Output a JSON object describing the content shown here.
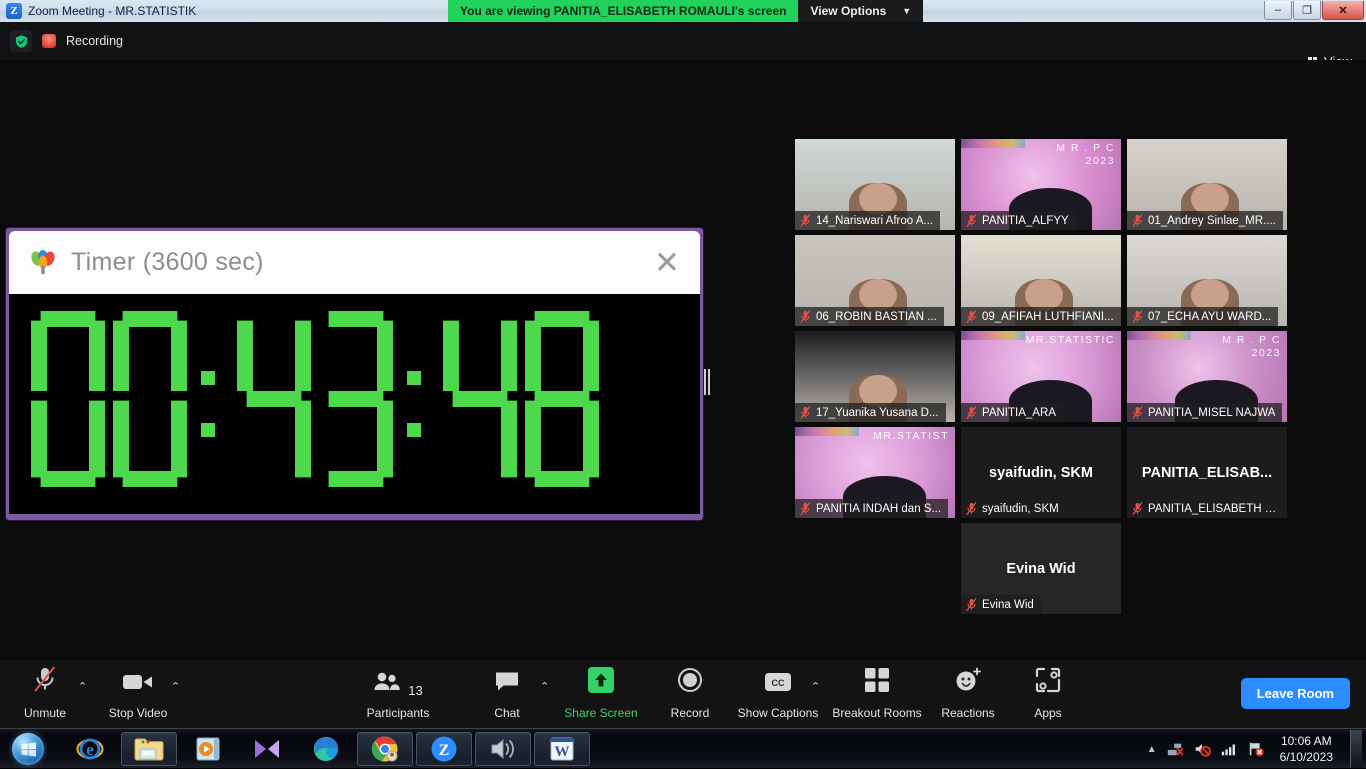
{
  "window": {
    "title": "Zoom Meeting - MR.STATISTIK",
    "app_icon": "zoom-icon",
    "minimize_label": "–",
    "restore_label": "❐",
    "close_label": "✕"
  },
  "share_banner": {
    "viewing_text": "You are viewing PANITIA_ELISABETH ROMAULI's screen",
    "view_options_label": "View Options",
    "chevron": "⌄",
    "green": "#21d35d"
  },
  "statusbar": {
    "recording_label": "Recording",
    "view_label": "View"
  },
  "timer": {
    "title": "Timer (3600 sec)",
    "close_label": "✕",
    "display": "00:43:48",
    "hours": "00",
    "minutes": "43",
    "seconds": "48",
    "segment_color": "#4dd84d",
    "frame_color": "#7b5aa0"
  },
  "tiles": [
    {
      "name": "14_Nariswari Afroo A...",
      "muted": true,
      "style": "photo",
      "bg": "#cfd9d6",
      "active": false,
      "big": ""
    },
    {
      "name": "PANITIA_ALFYY",
      "muted": true,
      "style": "virtual",
      "bg": "#d98fd0",
      "brand": "M R . P C\n2023",
      "active": false,
      "big": ""
    },
    {
      "name": "01_Andrey Sinlae_MR....",
      "muted": true,
      "style": "photo",
      "bg": "#d8d2cc",
      "active": false,
      "big": ""
    },
    {
      "name": "06_ROBIN BASTIAN ...",
      "muted": true,
      "style": "photo",
      "bg": "#c9c6bd",
      "active": false,
      "big": ""
    },
    {
      "name": "09_AFIFAH LUTHFIANI...",
      "muted": true,
      "style": "photo",
      "bg": "#e2e0d2",
      "active": false,
      "big": ""
    },
    {
      "name": "07_ECHA AYU WARD...",
      "muted": true,
      "style": "photo",
      "bg": "#dcd8d4",
      "active": false,
      "big": ""
    },
    {
      "name": "17_Yuanika Yusana D...",
      "muted": true,
      "style": "photo",
      "bg": "#1c1c1e",
      "active": false,
      "big": ""
    },
    {
      "name": "PANITIA_ARA",
      "muted": true,
      "style": "virtual",
      "bg": "#d99ad6",
      "brand": "MR.STATISTIC",
      "active": true,
      "big": ""
    },
    {
      "name": "PANITIA_MISEL NAJWA",
      "muted": true,
      "style": "virtual",
      "bg": "#c98fc6",
      "brand": "M R . P C\n2023",
      "active": false,
      "big": ""
    },
    {
      "name": "PANITIA INDAH dan S...",
      "muted": true,
      "style": "virtual",
      "bg": "#d99ad6",
      "brand": "MR.STATIST",
      "active": false,
      "big": ""
    },
    {
      "name": "syaifudin, SKM",
      "muted": true,
      "style": "name-only",
      "bg": "#1c1c1e",
      "active": false,
      "big": "syaifudin, SKM"
    },
    {
      "name": "PANITIA_ELISABETH R...",
      "muted": true,
      "style": "name-only",
      "bg": "#1c1c1e",
      "active": false,
      "big": "PANITIA_ELISAB..."
    },
    {
      "name": "Evina Wid",
      "muted": true,
      "style": "name-only",
      "bg": "#262628",
      "active": false,
      "big": "Evina Wid"
    }
  ],
  "controls": [
    {
      "id": "unmute",
      "label": "Unmute",
      "icon": "microphone-muted-icon",
      "caret": true,
      "green": false
    },
    {
      "id": "stop-video",
      "label": "Stop Video",
      "icon": "video-camera-icon",
      "caret": true,
      "green": false
    },
    {
      "id": "participants",
      "label": "Participants",
      "icon": "people-icon",
      "caret": false,
      "green": false,
      "count": "13"
    },
    {
      "id": "chat",
      "label": "Chat",
      "icon": "chat-bubble-icon",
      "caret": true,
      "green": false
    },
    {
      "id": "share-screen",
      "label": "Share Screen",
      "icon": "share-screen-icon",
      "caret": false,
      "green": true
    },
    {
      "id": "record",
      "label": "Record",
      "icon": "record-circle-icon",
      "caret": false,
      "green": false
    },
    {
      "id": "show-captions",
      "label": "Show Captions",
      "icon": "closed-caption-icon",
      "caret": true,
      "green": false
    },
    {
      "id": "breakout-rooms",
      "label": "Breakout Rooms",
      "icon": "grid-squares-icon",
      "caret": false,
      "green": false
    },
    {
      "id": "reactions",
      "label": "Reactions",
      "icon": "smiley-plus-icon",
      "caret": false,
      "green": false
    },
    {
      "id": "apps",
      "label": "Apps",
      "icon": "apps-bracket-icon",
      "caret": false,
      "green": false
    }
  ],
  "leave_button": {
    "label": "Leave Room",
    "color": "#2d8cff"
  },
  "taskbar": {
    "start_label": "start-orb",
    "items": [
      {
        "id": "internet-explorer",
        "icon": "internet-explorer-icon",
        "framed": false
      },
      {
        "id": "windows-explorer",
        "icon": "folder-icon",
        "framed": true
      },
      {
        "id": "media-player",
        "icon": "media-player-icon",
        "framed": false
      },
      {
        "id": "movie-maker",
        "icon": "movie-maker-icon",
        "framed": false
      },
      {
        "id": "microsoft-edge",
        "icon": "edge-icon",
        "framed": false
      },
      {
        "id": "google-chrome",
        "icon": "chrome-icon",
        "framed": true
      },
      {
        "id": "zoom",
        "icon": "zoom-icon",
        "framed": true
      },
      {
        "id": "volume-app",
        "icon": "speaker-icon",
        "framed": true
      },
      {
        "id": "word",
        "icon": "word-icon",
        "framed": true
      }
    ],
    "tray": {
      "arrow": "▲",
      "icons": [
        "network-error-icon",
        "volume-muted-icon",
        "signal-bars-icon",
        "flag-error-icon"
      ],
      "time": "10:06 AM",
      "date": "6/10/2023"
    }
  }
}
